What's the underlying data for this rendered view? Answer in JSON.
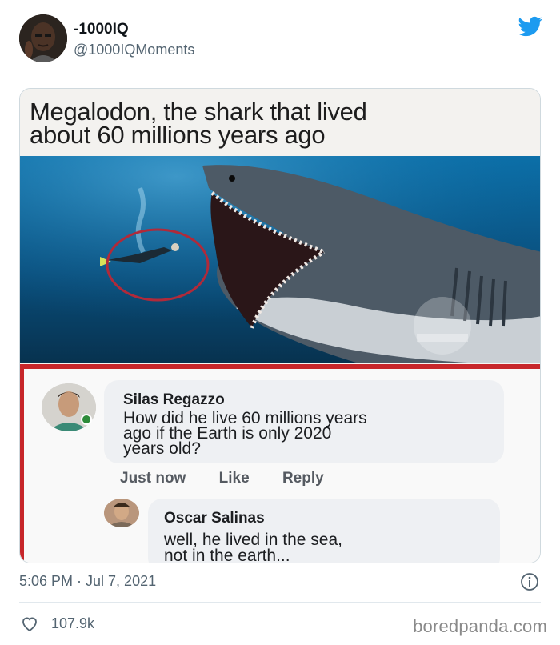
{
  "tweet": {
    "display_name": "-1000IQ",
    "handle": "@1000IQMoments",
    "timestamp": "5:06 PM · Jul 7, 2021",
    "like_count": "107.9k"
  },
  "media": {
    "title_line1": "Megalodon, the shark that lived",
    "title_line2": "about 60 millions years ago",
    "comments": [
      {
        "author": "Silas Regazzo",
        "line1": "How did he live 60 millions years",
        "line2": "ago if the Earth is only 2020",
        "line3": "years old?"
      },
      {
        "author": "Oscar Salinas",
        "line1": "well, he lived in the sea,",
        "line2": "not in the earth..."
      }
    ],
    "actions": {
      "time": "Just now",
      "like": "Like",
      "reply": "Reply"
    }
  },
  "watermark": "boredpanda.com",
  "colors": {
    "twitter_blue": "#1d9bf0",
    "circle_red": "#b02a3a",
    "frame_red": "#c7262a",
    "ocean_top": "#0c6fa8",
    "ocean_bottom": "#07324f"
  },
  "icons": {
    "brand": "twitter-bird-icon",
    "info": "info-icon",
    "like": "heart-icon"
  }
}
